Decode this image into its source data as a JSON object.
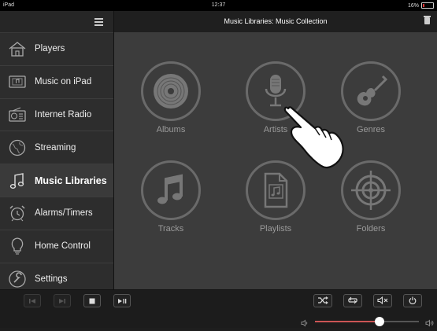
{
  "status_bar": {
    "carrier": "iPad",
    "time": "12:37",
    "battery": "16%"
  },
  "main": {
    "title": "Music Libraries: Music Collection"
  },
  "sidebar": {
    "items": [
      {
        "label": "Players",
        "icon": "home-icon",
        "active": false
      },
      {
        "label": "Music on iPad",
        "icon": "music-note-box-icon",
        "active": false
      },
      {
        "label": "Internet Radio",
        "icon": "radio-icon",
        "active": false
      },
      {
        "label": "Streaming",
        "icon": "globe-icon",
        "active": false
      },
      {
        "label": "Music Libraries",
        "icon": "music-note-icon",
        "active": true
      },
      {
        "label": "Alarms/Timers",
        "icon": "alarm-clock-icon",
        "active": false
      },
      {
        "label": "Home Control",
        "icon": "lightbulb-icon",
        "active": false
      },
      {
        "label": "Settings",
        "icon": "settings-icon",
        "active": false
      }
    ]
  },
  "categories": [
    {
      "label": "Albums",
      "icon": "album-disc-icon"
    },
    {
      "label": "Artists",
      "icon": "microphone-icon"
    },
    {
      "label": "Genres",
      "icon": "guitar-icon"
    },
    {
      "label": "Tracks",
      "icon": "music-note-icon"
    },
    {
      "label": "Playlists",
      "icon": "playlist-file-icon"
    },
    {
      "label": "Folders",
      "icon": "target-icon"
    }
  ],
  "volume": {
    "level": 0.62
  },
  "colors": {
    "accent": "#cc5555",
    "tile_border": "#6a6a6a",
    "tile_label": "#9a9a9a"
  }
}
